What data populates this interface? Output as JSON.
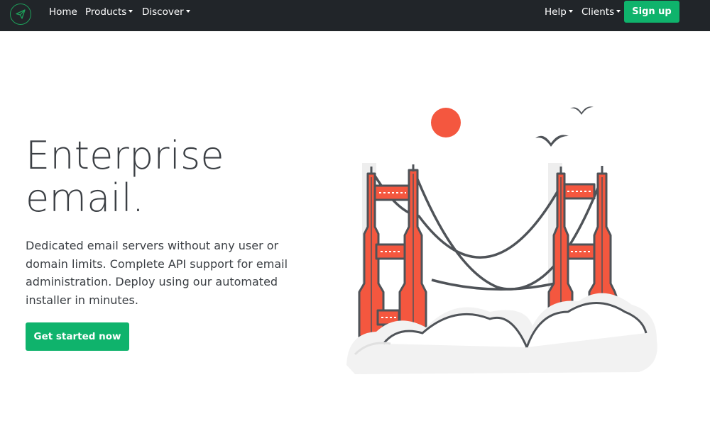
{
  "navbar": {
    "logo_icon": "paper-plane-icon",
    "left_items": [
      {
        "label": "Home",
        "dropdown": false
      },
      {
        "label": "Products",
        "dropdown": true
      },
      {
        "label": "Discover",
        "dropdown": true
      }
    ],
    "right_items": [
      {
        "label": "Help",
        "dropdown": true
      },
      {
        "label": "Clients",
        "dropdown": true
      }
    ],
    "signup_label": "Sign up"
  },
  "hero": {
    "title_line1": "Enterprise",
    "title_line2": "email.",
    "description": "Dedicated email servers without any user or domain limits. Complete API support for email administration. Deploy using our automated installer in minutes.",
    "cta_label": "Get started now"
  },
  "illustration": {
    "name": "golden-gate-bridge-illustration",
    "colors": {
      "tower_red": "#f4573f",
      "outline": "#4f5358",
      "sun": "#f4573f",
      "cloud": "#f2f2f2",
      "bird": "#4f5358"
    }
  },
  "colors": {
    "navbar_bg": "#212529",
    "accent_green": "#0fb36c",
    "text_dark": "#3b3f44"
  }
}
